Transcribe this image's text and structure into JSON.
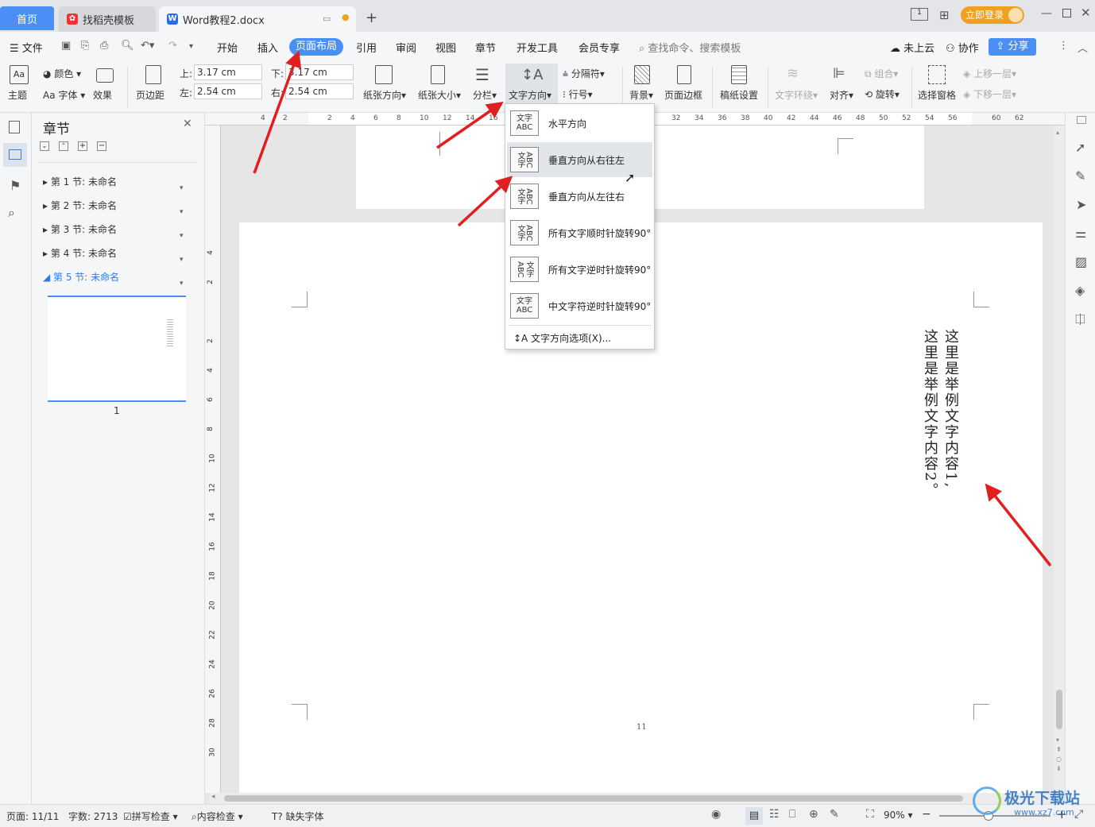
{
  "tabs": {
    "home": "首页",
    "template": "找稻壳模板",
    "document": "Word教程2.docx",
    "add": "+"
  },
  "titlebar": {
    "login": "立即登录"
  },
  "menu": {
    "file": "文件",
    "items": [
      "开始",
      "插入",
      "页面布局",
      "引用",
      "审阅",
      "视图",
      "章节",
      "开发工具",
      "会员专享"
    ],
    "active": "页面布局",
    "search_placeholder": "查找命令、搜索模板",
    "cloud": "未上云",
    "collab": "协作",
    "share": "分享"
  },
  "ribbon": {
    "theme": "主题",
    "color": "颜色",
    "font": "字体",
    "effect": "效果",
    "margins": "页边距",
    "top_label": "上:",
    "top_value": "3.17 cm",
    "bottom_label": "下:",
    "bottom_value": "3.17 cm",
    "left_label": "左:",
    "left_value": "2.54 cm",
    "right_label": "右:",
    "right_value": "2.54 cm",
    "orientation": "纸张方向",
    "size": "纸张大小",
    "columns": "分栏",
    "text_direction": "文字方向",
    "breaks": "分隔符",
    "line_numbers": "行号",
    "background": "背景",
    "page_border": "页面边框",
    "manuscript": "稿纸设置",
    "wrap": "文字环绕",
    "align": "对齐",
    "group": "组合",
    "rotate": "旋转",
    "selection_pane": "选择窗格",
    "bring_forward": "上移一层",
    "send_backward": "下移一层"
  },
  "text_direction_menu": {
    "items": [
      {
        "icon": "文字ABC",
        "label": "水平方向"
      },
      {
        "icon": "ABC文字",
        "label": "垂直方向从右往左"
      },
      {
        "icon": "文字ABC",
        "label": "垂直方向从左往右"
      },
      {
        "icon": "ABC文字",
        "label": "所有文字顺时针旋转90°"
      },
      {
        "icon": "ABC文字",
        "label": "所有文字逆时针旋转90°"
      },
      {
        "icon": "文字ABC",
        "label": "中文字符逆时针旋转90°"
      }
    ],
    "options": "文字方向选项(X)..."
  },
  "nav": {
    "title": "章节",
    "sections": [
      "第 1 节: 未命名",
      "第 2 节: 未命名",
      "第 3 节: 未命名",
      "第 4 节: 未命名",
      "第 5 节: 未命名"
    ],
    "active_index": 4,
    "thumb_page": "1"
  },
  "ruler_h": [
    "4",
    "2",
    "2",
    "4",
    "6",
    "8",
    "10",
    "12",
    "14",
    "16",
    "32",
    "34",
    "36",
    "38",
    "40",
    "42",
    "44",
    "46",
    "48",
    "50",
    "52",
    "54",
    "56",
    "60",
    "62"
  ],
  "ruler_v": [
    "4",
    "2",
    "2",
    "4",
    "6",
    "8",
    "10",
    "12",
    "14",
    "16",
    "18",
    "20",
    "22",
    "24",
    "26",
    "28",
    "30"
  ],
  "document": {
    "line1": "这里是举例文字内容1,",
    "line2": "这里是举例文字内容2。",
    "page_number": "11"
  },
  "status": {
    "page": "页面: 11/11",
    "words": "字数: 2713",
    "spell": "拼写检查",
    "content_check": "内容检查",
    "missing_font": "缺失字体",
    "zoom": "90%"
  },
  "watermark": {
    "name": "极光下载站",
    "url": "www.xz7.com"
  },
  "colors": {
    "accent": "#4a8ff5",
    "arrow": "#e02020",
    "login": "#f0a020"
  }
}
